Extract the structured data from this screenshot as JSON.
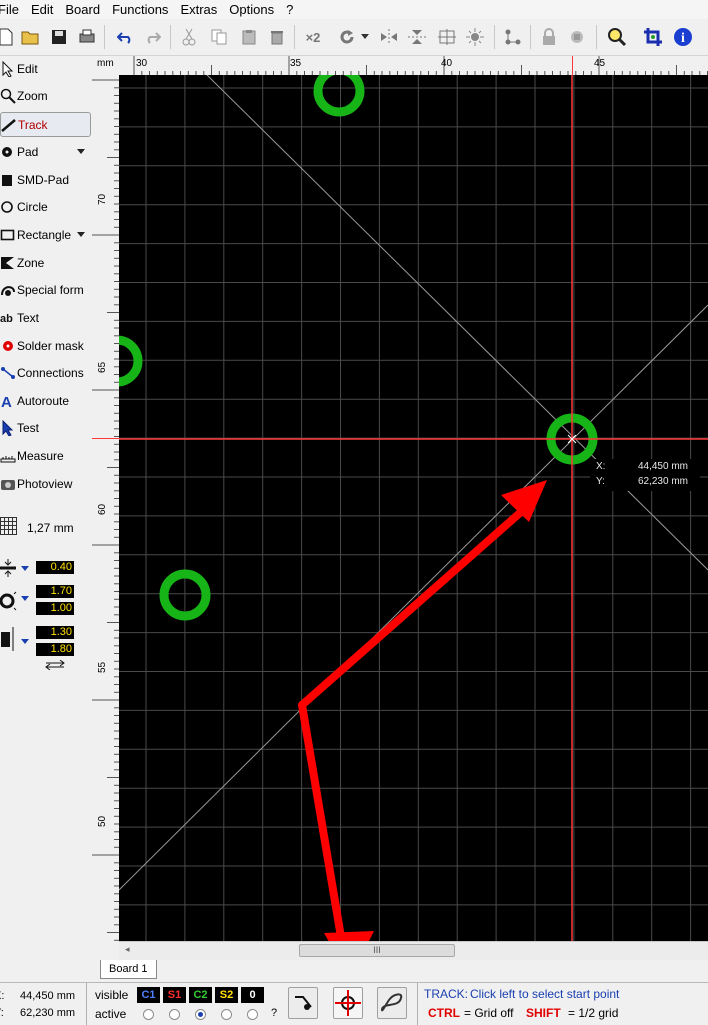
{
  "menu": [
    "File",
    "Edit",
    "Board",
    "Functions",
    "Extras",
    "Options",
    "?"
  ],
  "toolbar": {
    "items": [
      "new-icon",
      "open-icon",
      "save-icon",
      "print-icon",
      "undo-icon",
      "redo-icon",
      "cut-icon",
      "copy-icon",
      "paste-icon",
      "delete-icon",
      "multiply-icon",
      "rotate-icon",
      "mirror-horizontal-icon",
      "mirror-vertical-icon",
      "align-icon",
      "snap-icon",
      "connections-icon",
      "lock-icon",
      "unlock-icon",
      "zoom-icon",
      "crop-icon",
      "info-icon"
    ],
    "multiply_label": "×2"
  },
  "sidebar": {
    "items": [
      {
        "label": "Edit",
        "icon": "cursor-icon"
      },
      {
        "label": "Zoom",
        "icon": "magnifier-icon"
      },
      {
        "label": "Track",
        "icon": "track-icon",
        "active": true
      },
      {
        "label": "Pad",
        "icon": "pad-icon",
        "dropdown": true
      },
      {
        "label": "SMD-Pad",
        "icon": "smd-pad-icon"
      },
      {
        "label": "Circle",
        "icon": "circle-icon"
      },
      {
        "label": "Rectangle",
        "icon": "rectangle-icon",
        "dropdown": true
      },
      {
        "label": "Zone",
        "icon": "zone-icon"
      },
      {
        "label": "Special form",
        "icon": "special-form-icon"
      },
      {
        "label": "Text",
        "icon": "text-icon"
      },
      {
        "label": "Solder mask",
        "icon": "solder-mask-icon"
      },
      {
        "label": "Connections",
        "icon": "connections-icon"
      },
      {
        "label": "Autoroute",
        "icon": "autoroute-icon"
      },
      {
        "label": "Test",
        "icon": "test-icon"
      },
      {
        "label": "Measure",
        "icon": "measure-icon"
      },
      {
        "label": "Photoview",
        "icon": "photoview-icon"
      }
    ],
    "grid": "1,27 mm",
    "track_width": "0.40",
    "pad_outer": "1.70",
    "pad_inner": "1.00",
    "smd_width": "1.30",
    "smd_height": "1.80"
  },
  "rulers": {
    "unit": "mm",
    "x_ticks": [
      "30",
      "35",
      "40",
      "45"
    ],
    "y_ticks": [
      "70",
      "65",
      "60",
      "55",
      "50"
    ]
  },
  "canvas": {
    "cursor": {
      "x_label": "X:",
      "x_value": "44,450 mm",
      "y_label": "Y:",
      "y_value": "62,230 mm"
    },
    "colors": {
      "background": "#000000",
      "grid": "#4a4a4a",
      "pad": "#17b417",
      "crosshair": "#ff3838",
      "annotation_arrow": "#ff0000"
    }
  },
  "scroll": {
    "thumb_label": "III"
  },
  "tabs": [
    "Board 1"
  ],
  "status": {
    "x_label": "X:",
    "x_value": "44,450 mm",
    "y_label": "Y:",
    "y_value": "62,230 mm",
    "visible_label": "visible",
    "active_label": "active",
    "layers": [
      {
        "name": "C1",
        "color": "#4f7fff"
      },
      {
        "name": "S1",
        "color": "#ff3030"
      },
      {
        "name": "C2",
        "color": "#33cc33"
      },
      {
        "name": "S2",
        "color": "#ffe000"
      },
      {
        "name": "0",
        "color": "#ffffff"
      }
    ],
    "question": "?",
    "hint_title": "TRACK:",
    "hint_text": "Click left to select start point",
    "ctrl_key": "CTRL",
    "ctrl_text": "= Grid off",
    "shift_key": "SHIFT",
    "shift_text": "= 1/2 grid"
  }
}
